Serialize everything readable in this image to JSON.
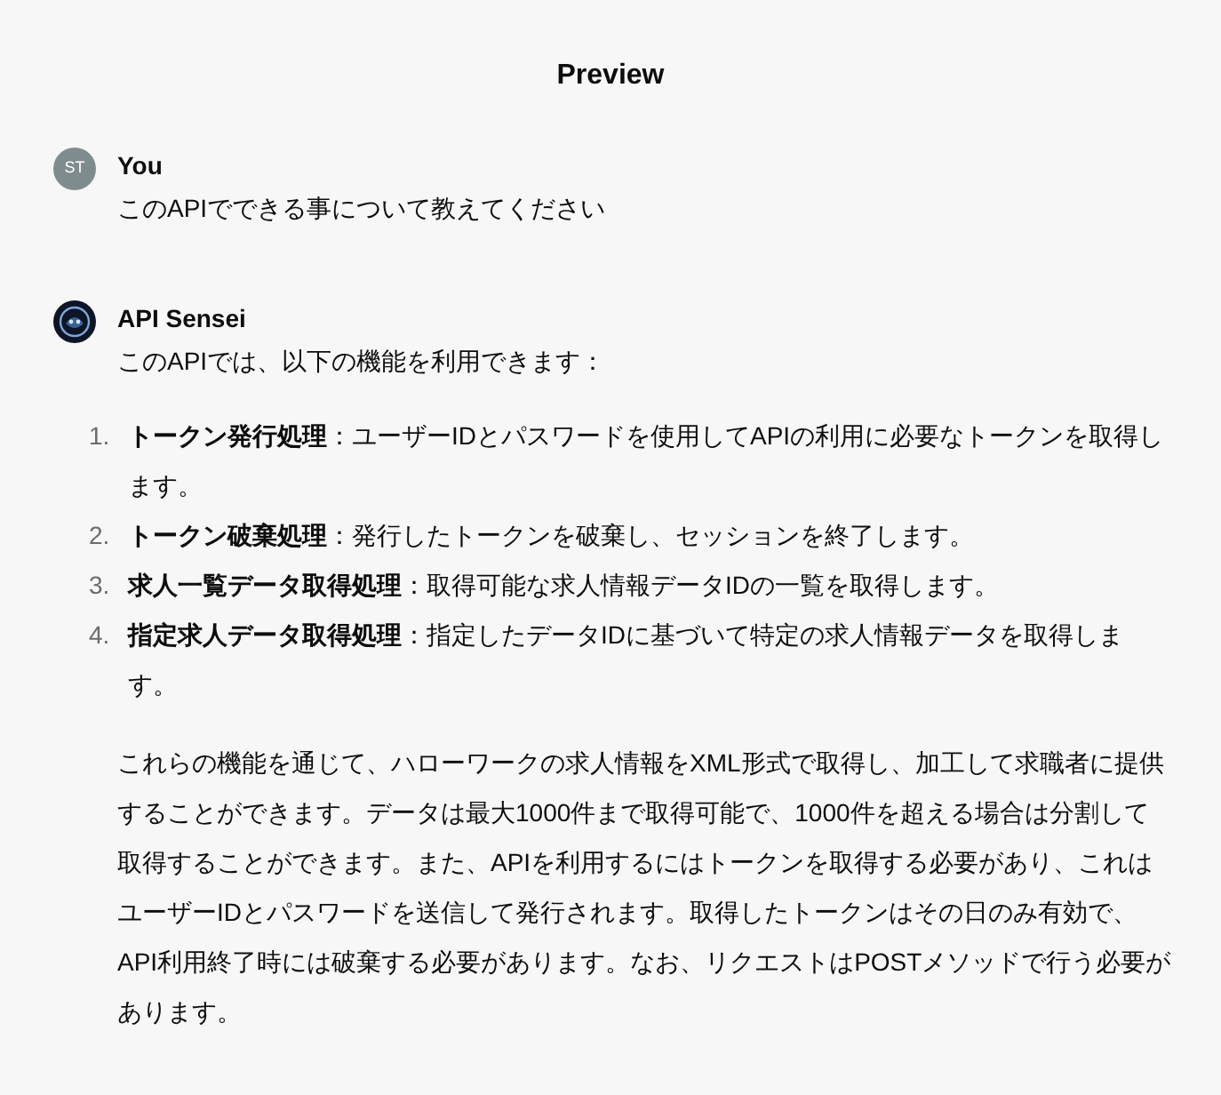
{
  "title": "Preview",
  "messages": [
    {
      "kind": "user",
      "avatar": "ST",
      "author": "You",
      "text": "このAPIでできる事について教えてください"
    },
    {
      "kind": "bot",
      "author": "API Sensei",
      "intro": "このAPIでは、以下の機能を利用できます：",
      "items": [
        {
          "number": "1.",
          "text": "**トークン発行処理**：ユーザーIDとパスワードを使用してAPIの利用に必要なトークンを取得します。"
        },
        {
          "number": "2.",
          "text": "**トークン破棄処理**：発行したトークンを破棄し、セッションを終了します。"
        },
        {
          "number": "3.",
          "text": "**求人一覧データ取得処理**：取得可能な求人情報データIDの一覧を取得します。"
        },
        {
          "number": "4.",
          "text": "**指定求人データ取得処理**：指定したデータIDに基づいて特定の求人情報データを取得します。"
        }
      ],
      "summary": "これらの機能を通じて、ハローワークの求人情報をXML形式で取得し、加工して求職者に提供することができます。データは最大1000件まで取得可能で、1000件を超える場合は分割して取得することができます。また、APIを利用するにはトークンを取得する必要があり、これはユーザーIDとパスワードを送信して発行されます。取得したトークンはその日のみ有効で、API利用終了時には破棄する必要があります。なお、リクエストはPOSTメソッドで行う必要があります。"
    }
  ]
}
